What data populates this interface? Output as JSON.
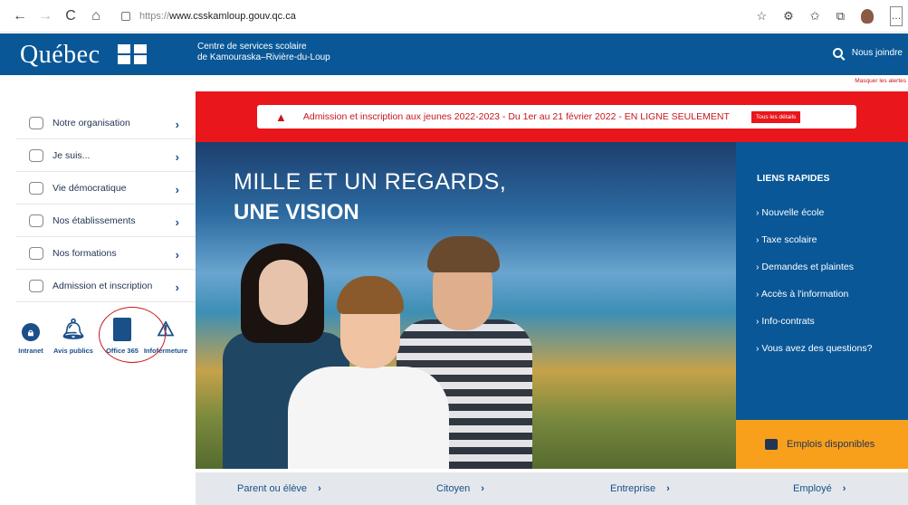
{
  "browser": {
    "url_protocol": "https://",
    "url_host": "www.csskamloup.gouv.qc.ca",
    "back_icon": "←",
    "forward_icon": "→",
    "reload_icon": "C",
    "home_icon": "⌂",
    "more_icon": "…"
  },
  "header": {
    "logo": "Québec",
    "org_name_line1": "Centre de services scolaire",
    "org_name_line2": "de Kamouraska–Rivière-du-Loup",
    "contact": "Nous joindre"
  },
  "alerts": {
    "hide_link": "Masquer les alertes",
    "message": "Admission et inscription aux jeunes 2022-2023 - Du 1er au 21 février 2022 - EN LIGNE SEULEMENT",
    "details_button": "Tous les détails"
  },
  "sidebar": {
    "items": [
      {
        "label": "Notre organisation"
      },
      {
        "label": "Je suis..."
      },
      {
        "label": "Vie démocratique"
      },
      {
        "label": "Nos établissements"
      },
      {
        "label": "Nos formations"
      },
      {
        "label": "Admission et inscription"
      }
    ],
    "chevron": "›"
  },
  "quick_icons": [
    {
      "label": "Intranet",
      "icon": "lock-icon"
    },
    {
      "label": "Avis publics",
      "icon": "bell-icon"
    },
    {
      "label": "Office 365",
      "icon": "office-icon"
    },
    {
      "label": "Infofermeture",
      "icon": "warning-icon"
    }
  ],
  "hero": {
    "line1": "MILLE ET UN REGARDS,",
    "line2": "UNE VISION"
  },
  "quick_links": {
    "title": "LIENS RAPIDES",
    "items": [
      "› Nouvelle école",
      "› Taxe scolaire",
      "› Demandes et plaintes",
      "› Accès à l'information",
      "› Info-contrats",
      "› Vous avez des questions?"
    ]
  },
  "jobs": {
    "label": "Emplois disponibles"
  },
  "bottom_nav": {
    "items": [
      "Parent ou élève",
      "Citoyen",
      "Entreprise",
      "Employé"
    ],
    "chevron": "›"
  },
  "colors": {
    "brand_blue": "#095797",
    "alert_red": "#e9161c",
    "jobs_orange": "#f8a01c"
  }
}
